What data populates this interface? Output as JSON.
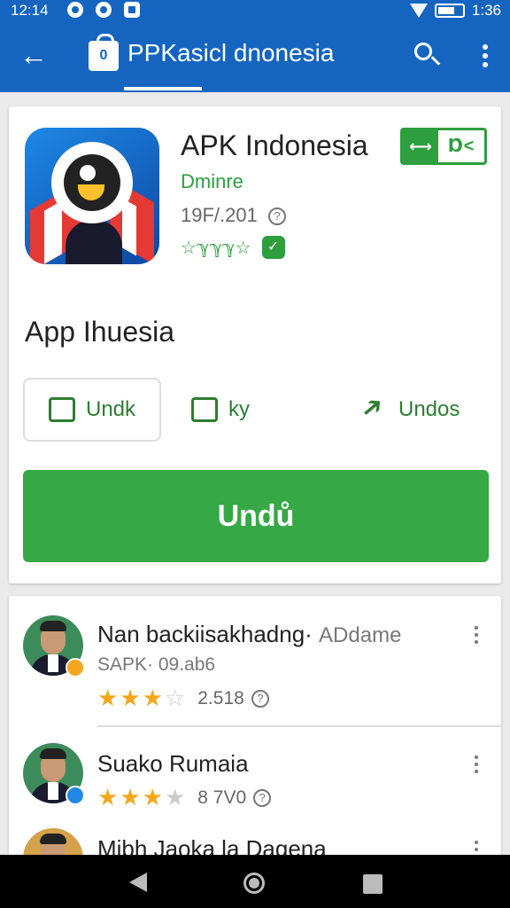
{
  "status_bar": {
    "time": "12:14",
    "clock_right": "1:36"
  },
  "app_bar": {
    "title": "PPKasicl dnonesia",
    "bag_badge": "0",
    "back_icon": "arrow-left-icon",
    "search_icon": "search-icon",
    "more_icon": "more-vertical-icon"
  },
  "app": {
    "name": "APK Indonesia",
    "install_badge": {
      "left": "⟷",
      "right": "Ɒ<"
    },
    "developer": "Dminre",
    "date": "19F/.201",
    "help_glyph": "?",
    "rating_text": "☆ℽℽℽ☆",
    "shield_glyph": "✓",
    "subtitle": "App Ihuesia",
    "options": [
      {
        "label": "Undk",
        "icon": "download-box-icon"
      },
      {
        "label": "ky",
        "icon": "tv-icon"
      },
      {
        "label": "Undos",
        "icon": "arrow-icon"
      }
    ],
    "primary_button": "Undů",
    "colors": {
      "accent": "#36a845",
      "brand": "#1565c0"
    }
  },
  "reviews": [
    {
      "name": "Nan backiisakhadng·",
      "tag": "ADdame",
      "sub": "SAPK·  09.ab6",
      "stars": 3,
      "count": "2.518",
      "help_glyph": "?"
    },
    {
      "name": "Suako Rumaia",
      "tag": "",
      "sub": "",
      "stars": 3,
      "count": "8 7V0",
      "help_glyph": "?"
    },
    {
      "name": "Mibh Jaoka la Dagena",
      "tag": "",
      "sub": "",
      "stars": 0,
      "count": "",
      "help_glyph": ""
    }
  ],
  "nav": {
    "back": "nav-back-icon",
    "home": "nav-home-icon",
    "recent": "nav-recent-icon"
  }
}
